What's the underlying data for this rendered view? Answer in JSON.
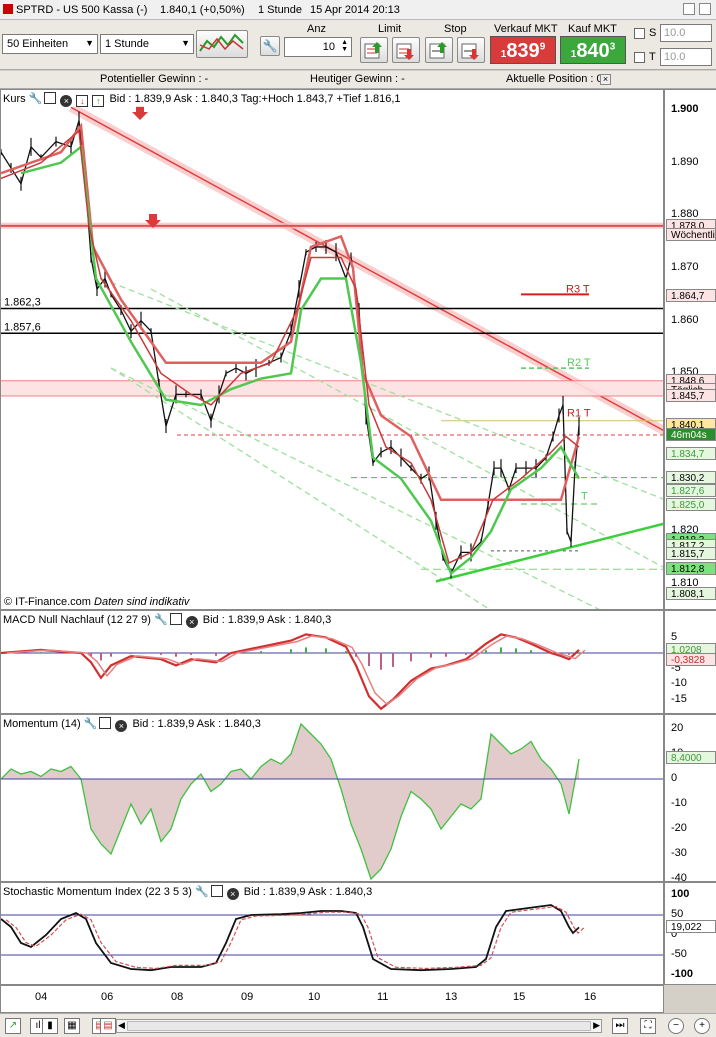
{
  "titlebar": {
    "instrument": "SPTRD - US 500 Kassa (-)",
    "price": "1.840,1 (+0,50%)",
    "interval": "1 Stunde",
    "datetime": "15 Apr 2014 20:13"
  },
  "toolbar": {
    "units_select": "50 Einheiten",
    "interval_select": "1 Stunde",
    "anz_label": "Anz",
    "anz_value": "10",
    "limit_label": "Limit",
    "stop_label": "Stop",
    "sell_label": "Verkauf MKT",
    "buy_label": "Kauf MKT",
    "sell_price_small": "1",
    "sell_price_big": "839",
    "sell_price_sup": "9",
    "buy_price_small": "1",
    "buy_price_big": "840",
    "buy_price_sup": "3",
    "s_label": "S",
    "t_label": "T",
    "s_value": "10.0",
    "t_value": "10.0",
    "sell_color": "#d93b3b",
    "buy_color": "#3aa83a"
  },
  "summary": {
    "potential": "Potentieller Gewinn : -",
    "today": "Heutiger Gewinn : -",
    "position": "Aktuelle Position : 0"
  },
  "main_panel": {
    "title": "Kurs",
    "quote": "Bid : 1.839,9 Ask : 1.840,3 Tag:+Hoch 1.843,7 +Tief 1.816,1",
    "credit": "© IT-Finance.com",
    "credit_note": "Daten sind indikativ",
    "y_ticks": [
      "1.900",
      "1.890",
      "1.880",
      "1.870",
      "1.860",
      "1.850",
      "1.840",
      "1.830",
      "1.820",
      "1.810"
    ],
    "level_labels": {
      "l1862": "1.862,3",
      "l1857": "1.857,6",
      "r3": "R3 T",
      "r2": "R2 T",
      "r1": "R1 T",
      "p": "T"
    },
    "tags": [
      {
        "text": "1.878,0",
        "bg": "#fde4e4",
        "fg": "#000"
      },
      {
        "text": "Wöchentli",
        "bg": "#fde4e4",
        "fg": "#000"
      },
      {
        "text": "1.864,7",
        "bg": "#fde4e4",
        "fg": "#000"
      },
      {
        "text": "1.848,6",
        "bg": "#fde4e4",
        "fg": "#000"
      },
      {
        "text": "Täglich",
        "bg": "#fde4e4",
        "fg": "#000"
      },
      {
        "text": "1.845,7",
        "bg": "#fde4e4",
        "fg": "#000"
      },
      {
        "text": "1.840,1",
        "bg": "#ffe89a",
        "fg": "#000"
      },
      {
        "text": "46m04s",
        "bg": "#2c8d2c",
        "fg": "#fff"
      },
      {
        "text": "1.834,7",
        "bg": "#e6f7e0",
        "fg": "#3a9a3a"
      },
      {
        "text": "1.830,2",
        "bg": "#e6f7e0",
        "fg": "#000"
      },
      {
        "text": "1.827,6",
        "bg": "#e6f7e0",
        "fg": "#3a9a3a"
      },
      {
        "text": "1.825,0",
        "bg": "#e6f7e0",
        "fg": "#3a9a3a"
      },
      {
        "text": "1.818,3",
        "bg": "#7fe07f",
        "fg": "#000"
      },
      {
        "text": "1.817,2",
        "bg": "#e6f7e0",
        "fg": "#000"
      },
      {
        "text": "1.815,7",
        "bg": "#e6f7e0",
        "fg": "#000"
      },
      {
        "text": "1.812,8",
        "bg": "#7fe07f",
        "fg": "#000"
      },
      {
        "text": "1.808,1",
        "bg": "#e6f7e0",
        "fg": "#000"
      }
    ]
  },
  "macd_panel": {
    "title": "MACD Null Nachlauf (12 27 9)",
    "quote": "Bid : 1.839,9 Ask : 1.840,3",
    "y_ticks": [
      "5",
      "0",
      "-5",
      "-10",
      "-15"
    ],
    "tags": [
      "1,0208",
      "-0,3828"
    ]
  },
  "momentum_panel": {
    "title": "Momentum (14)",
    "quote": "Bid : 1.839,9 Ask : 1.840,3",
    "y_ticks": [
      "20",
      "10",
      "0",
      "-10",
      "-20",
      "-30",
      "-40"
    ],
    "tag": "8,4000"
  },
  "smi_panel": {
    "title": "Stochastic Momentum Index (22 3 5 3)",
    "quote": "Bid : 1.839,9 Ask : 1.840,3",
    "y_ticks": [
      "100",
      "50",
      "0",
      "-50",
      "-100"
    ],
    "tag": "19,022"
  },
  "x_axis": {
    "labels": [
      "04",
      "06",
      "08",
      "09",
      "10",
      "11",
      "13",
      "15",
      "16"
    ]
  }
}
